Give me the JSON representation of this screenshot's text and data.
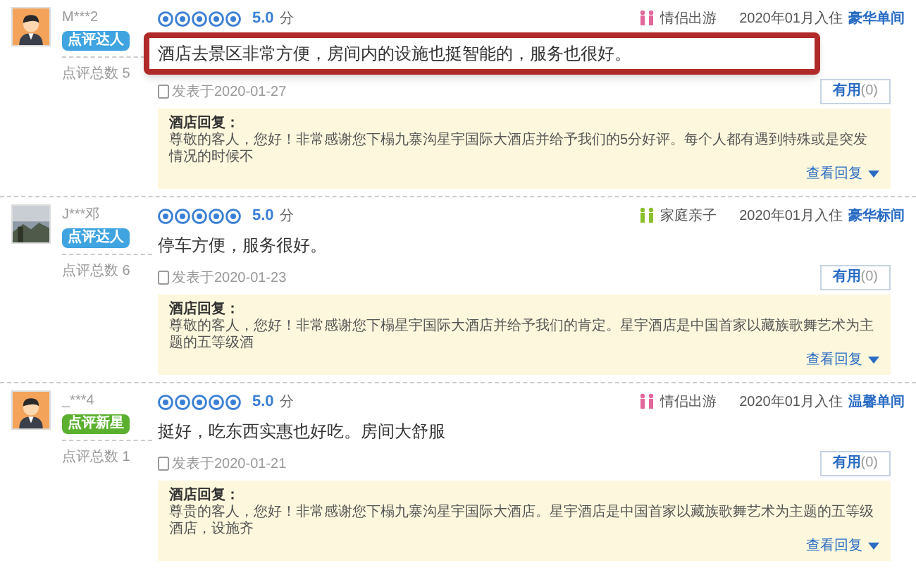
{
  "reviews": [
    {
      "user": {
        "name": "M***2",
        "avatar": {
          "kind": "person"
        },
        "badge": {
          "label": "点评达人",
          "color": "#3fa4e0"
        },
        "count": "点评总数 5"
      },
      "stars": 5,
      "score": "5.0",
      "score_unit": "分",
      "trip": {
        "label": "情侣出游",
        "color": "#e2679a"
      },
      "stay": "2020年01月入住",
      "room": "豪华单间",
      "text": "酒店去景区非常方便，房间内的设施也挺智能的，服务也很好。",
      "highlighted": true,
      "date": "发表于2020-01-27",
      "useful": {
        "label": "有用",
        "count": "(0)"
      },
      "reply": {
        "title": "酒店回复：",
        "text": "尊敬的客人，您好！非常感谢您下榻九寨沟星宇国际大酒店并给予我们的5分好评。每个人都有遇到特殊或是突发情况的时候不",
        "more": "查看回复"
      }
    },
    {
      "user": {
        "name": "J***邓",
        "badge": {
          "label": "点评达人",
          "color": "#3fa4e0"
        },
        "count": "点评总数 6"
      },
      "stars": 5,
      "score": "5.0",
      "score_unit": "分",
      "trip": {
        "label": "家庭亲子",
        "color": "#8bbf2e"
      },
      "stay": "2020年01月入住",
      "room": "豪华标间",
      "text": "停车方便，服务很好。",
      "highlighted": false,
      "date": "发表于2020-01-23",
      "useful": {
        "label": "有用",
        "count": "(0)"
      },
      "reply": {
        "title": "酒店回复：",
        "text": "尊敬的客人，您好！非常感谢您下榻星宇国际大酒店并给予我们的肯定。星宇酒店是中国首家以藏族歌舞艺术为主题的五等级酒",
        "more": "查看回复"
      }
    },
    {
      "user": {
        "name": "_***4",
        "avatar": {
          "kind": "person"
        },
        "badge": {
          "label": "点评新星",
          "color": "#5bb12f"
        },
        "count": "点评总数 1"
      },
      "stars": 5,
      "score": "5.0",
      "score_unit": "分",
      "trip": {
        "label": "情侣出游",
        "color": "#e2679a"
      },
      "stay": "2020年01月入住",
      "room": "温馨单间",
      "text": "挺好，吃东西实惠也好吃。房间大舒服",
      "highlighted": false,
      "date": "发表于2020-01-21",
      "useful": {
        "label": "有用",
        "count": "(0)"
      },
      "reply": {
        "title": "酒店回复：",
        "text": "尊贵的客人，您好！非常感谢您下榻九寨沟星宇国际大酒店。星宇酒店是中国首家以藏族歌舞艺术为主题的五等级酒店，设施齐",
        "more": "查看回复"
      }
    }
  ]
}
